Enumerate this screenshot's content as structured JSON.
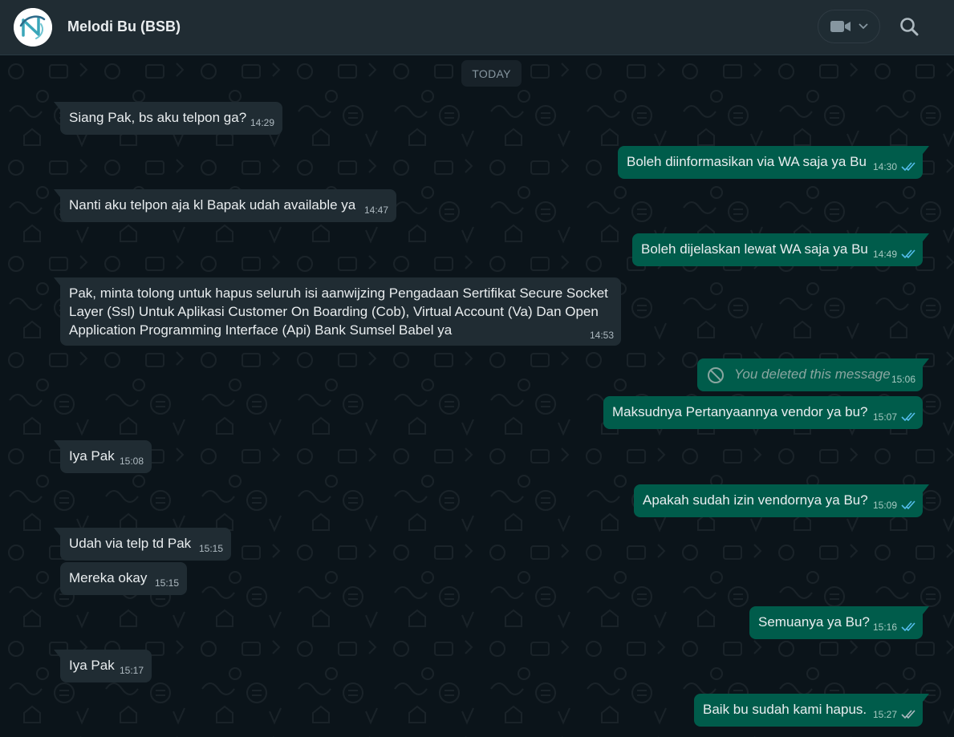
{
  "header": {
    "contact_name": "Melodi Bu (BSB)",
    "avatar_icon": "company-logo-icon",
    "video_icon": "video-call-icon",
    "dropdown_icon": "chevron-down-icon",
    "search_icon": "search-icon"
  },
  "chat": {
    "date_label": "TODAY",
    "messages": [
      {
        "dir": "in",
        "text": "Siang Pak, bs aku telpon ga?",
        "time": "14:29"
      },
      {
        "dir": "out",
        "text": "Boleh diinformasikan via WA saja ya Bu",
        "time": "14:30",
        "read": true
      },
      {
        "dir": "in",
        "text": "Nanti aku telpon aja kl Bapak udah available ya",
        "time": "14:47"
      },
      {
        "dir": "out",
        "text": "Boleh dijelaskan lewat WA saja ya Bu",
        "time": "14:49",
        "read": true
      },
      {
        "dir": "in",
        "text": "Pak, minta tolong untuk hapus seluruh isi aanwijzing Pengadaan Sertifikat Secure Socket Layer (Ssl) Untuk Aplikasi Customer On Boarding (Cob), Virtual Account (Va) Dan Open Application Programming Interface (Api) Bank Sumsel Babel ya",
        "time": "14:53"
      },
      {
        "dir": "out",
        "text": "You deleted this message",
        "time": "15:06",
        "deleted": true
      },
      {
        "dir": "out",
        "text": "Maksudnya Pertanyaannya vendor ya bu?",
        "time": "15:07",
        "read": true
      },
      {
        "dir": "in",
        "text": "Iya Pak",
        "time": "15:08"
      },
      {
        "dir": "out",
        "text": "Apakah sudah izin vendornya ya Bu?",
        "time": "15:09",
        "read": true
      },
      {
        "dir": "in",
        "text": "Udah via telp td Pak",
        "time": "15:15"
      },
      {
        "dir": "in",
        "text": "Mereka okay",
        "time": "15:15"
      },
      {
        "dir": "out",
        "text": "Semuanya ya Bu?",
        "time": "15:16",
        "read": true
      },
      {
        "dir": "in",
        "text": "Iya Pak",
        "time": "15:17"
      },
      {
        "dir": "out",
        "text": "Baik bu sudah kami hapus.",
        "time": "15:27",
        "read": false
      }
    ]
  },
  "colors": {
    "incoming_bubble": "#202c33",
    "outgoing_bubble": "#005c4b",
    "read_ticks": "#53bdeb",
    "delivered_ticks": "#aebac1"
  }
}
